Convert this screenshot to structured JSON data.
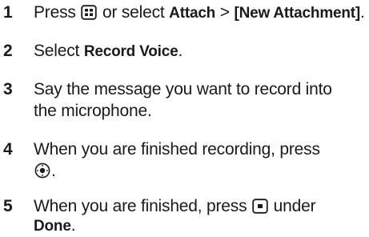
{
  "steps": [
    {
      "number": "1",
      "line1": {
        "t1": "Press ",
        "icon": "menu-key-icon",
        "t2": " or select ",
        "m1": "Attach",
        "t3": " > ",
        "m2": "[New Attachment]",
        "t4": "."
      }
    },
    {
      "number": "2",
      "line1": {
        "t1": "Select ",
        "m1": "Record Voice",
        "t2": "."
      }
    },
    {
      "number": "3",
      "line1": "Say the message you want to record into",
      "line2": "the microphone."
    },
    {
      "number": "4",
      "line1": "When you are finished recording, press",
      "line2_icon": "center-select-key-icon",
      "line2_text": "."
    },
    {
      "number": "5",
      "line1": {
        "t1": "When you are finished, press ",
        "icon": "soft-key-icon",
        "t2": " under"
      },
      "line2": {
        "m1": "Done",
        "t1": "."
      }
    }
  ]
}
